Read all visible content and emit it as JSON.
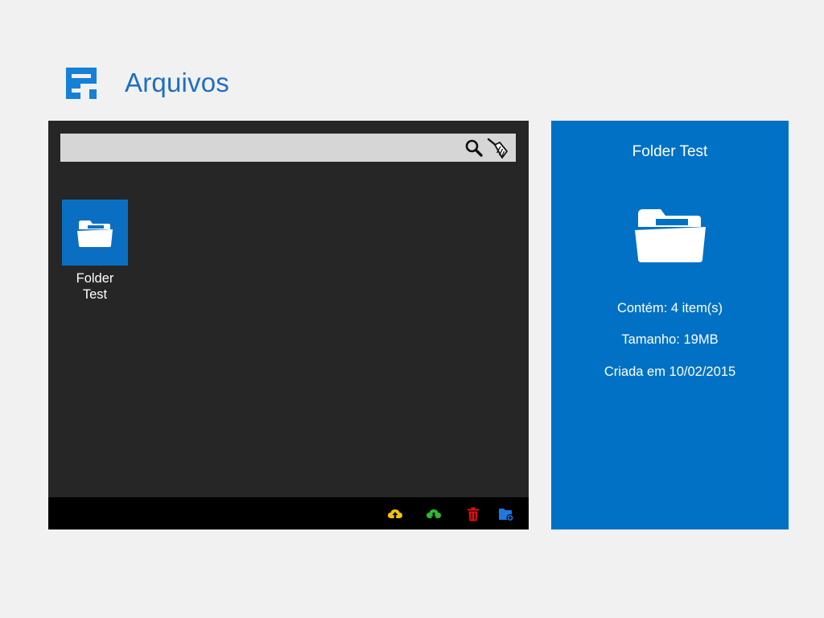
{
  "header": {
    "logo_icon": "app-logo-icon",
    "title": "Arquivos"
  },
  "colors": {
    "accent": "#0071c5",
    "tile": "#0a6fc2",
    "browser_background": "#262626",
    "action_bar": "#000000",
    "upload": "#f5c400",
    "download": "#2eb82e",
    "delete": "#e01010",
    "new_folder": "#1e78e0"
  },
  "search": {
    "value": "",
    "search_icon": "search-icon",
    "clear_icon": "broom-icon"
  },
  "browser": {
    "items": [
      {
        "type": "folder",
        "label": "Folder Test",
        "icon": "folder-open-icon"
      }
    ]
  },
  "actions": [
    {
      "name": "upload",
      "icon": "cloud-upload-icon"
    },
    {
      "name": "download",
      "icon": "cloud-download-icon"
    },
    {
      "name": "delete",
      "icon": "trash-icon"
    },
    {
      "name": "new-folder",
      "icon": "folder-add-icon"
    }
  ],
  "details": {
    "title": "Folder Test",
    "icon": "folder-open-icon",
    "contains": "Contém: 4 item(s)",
    "size": "Tamanho: 19MB",
    "created": "Criada em 10/02/2015"
  }
}
